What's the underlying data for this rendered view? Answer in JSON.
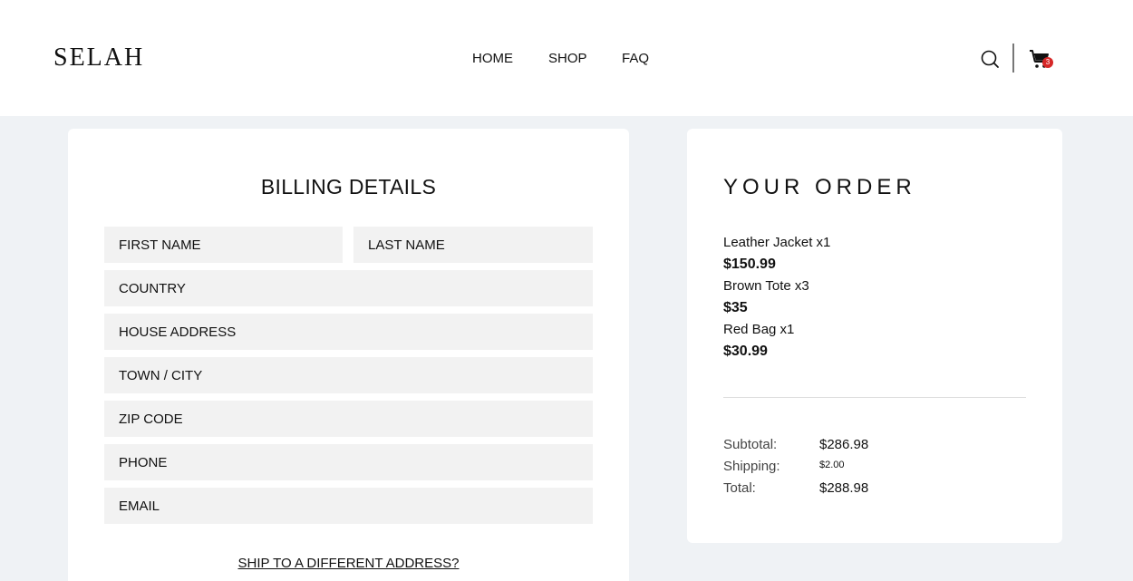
{
  "header": {
    "logo": "SELAH",
    "nav": [
      "HOME",
      "SHOP",
      "FAQ"
    ],
    "cart_count": "3",
    "icons": {
      "search": "search-icon",
      "cart": "cart-icon"
    }
  },
  "billing": {
    "title": "BILLING DETAILS",
    "fields": {
      "first_name": "FIRST NAME",
      "last_name": "LAST NAME",
      "country": "COUNTRY",
      "house_address": "HOUSE ADDRESS",
      "town_city": "TOWN / CITY",
      "zip_code": "ZIP CODE",
      "phone": "PHONE",
      "email": "EMAIL"
    },
    "ship_link": "SHIP TO A DIFFERENT ADDRESS?"
  },
  "order": {
    "title": "YOUR ORDER",
    "items": [
      {
        "name": "Leather Jacket x1",
        "price": "$150.99"
      },
      {
        "name": "Brown Tote x3",
        "price": "$35"
      },
      {
        "name": "Red Bag x1",
        "price": "$30.99"
      }
    ],
    "summary": {
      "subtotal_label": "Subtotal:",
      "subtotal": "$286.98",
      "shipping_label": "Shipping:",
      "shipping": "$2.00",
      "total_label": "Total:",
      "total": "$288.98"
    }
  },
  "colors": {
    "page_bg": "#eff2f5",
    "field_bg": "#f2f2f2",
    "badge": "#d62828"
  }
}
